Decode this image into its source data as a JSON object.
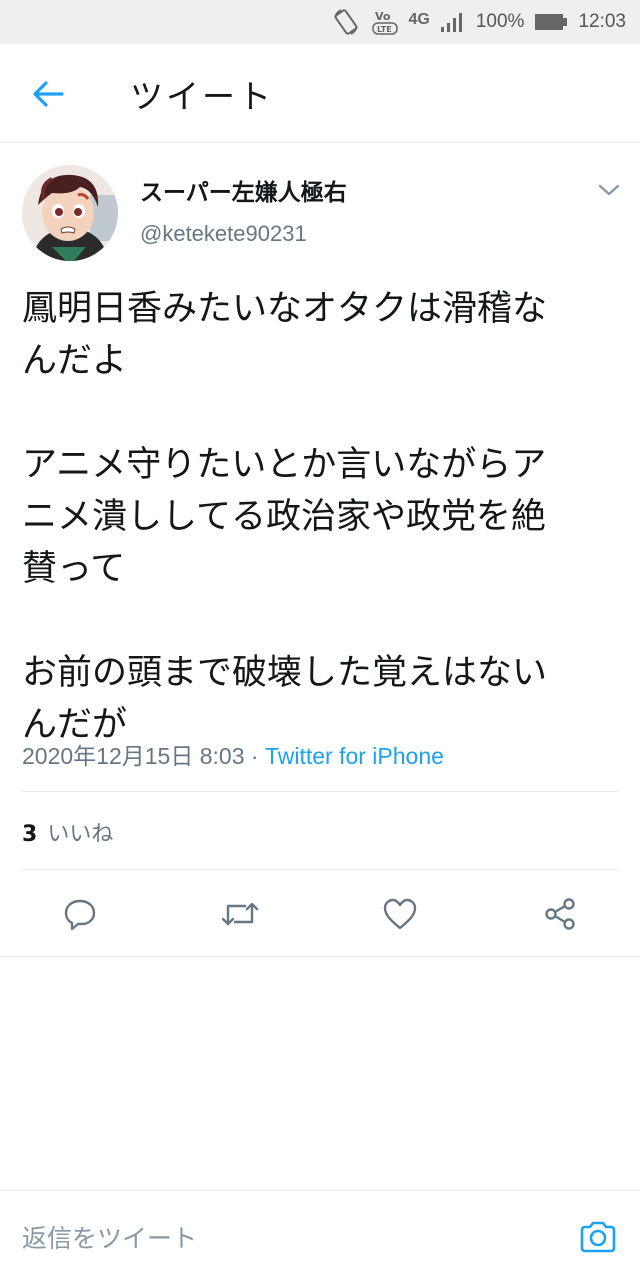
{
  "status_bar": {
    "network": "4G",
    "battery": "100%",
    "time": "12:03",
    "icons": [
      "rotate-icon",
      "volte-icon",
      "signal-icon",
      "battery-icon"
    ]
  },
  "header": {
    "title": "ツイート",
    "back_icon": "arrow-left-icon"
  },
  "tweet": {
    "author_name": "スーパー左嫌人極右",
    "author_handle": "@ketekete90231",
    "paragraphs": [
      [
        "鳳明日香みたいなオタクは滑稽な",
        "んだよ"
      ],
      [
        "アニメ守りたいとか言いながらア",
        "ニメ潰ししてる政治家や政党を絶",
        "賛って"
      ],
      [
        "お前の頭まで破壊した覚えはない",
        "んだが"
      ]
    ],
    "timestamp": "2020年12月15日 8:03",
    "separator": " · ",
    "source": "Twitter for iPhone",
    "like_count": "3",
    "like_label": "いいね"
  },
  "reply_bar": {
    "placeholder": "返信をツイート"
  },
  "colors": {
    "accent": "#1da1f2",
    "text": "#14171a",
    "muted": "#657786",
    "divider": "#e6ecf0",
    "status_bar_bg": "#efefef"
  }
}
